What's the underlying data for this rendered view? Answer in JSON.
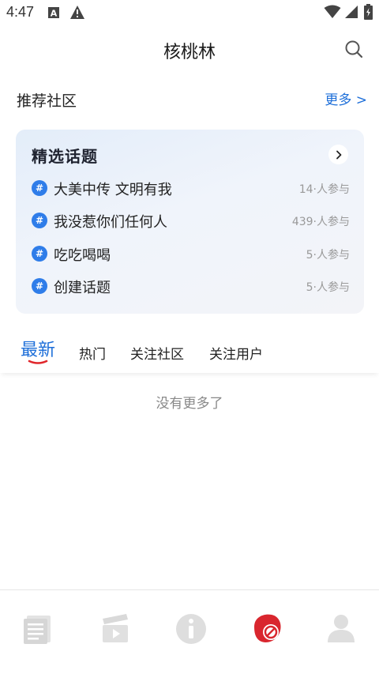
{
  "status_bar": {
    "time": "4:47",
    "icons": [
      "font-a-icon",
      "warning-icon",
      "wifi-icon",
      "signal-icon",
      "battery-icon"
    ]
  },
  "header": {
    "title": "核桃林",
    "search_icon": "search-icon"
  },
  "recommended": {
    "title": "推荐社区",
    "more_label": "更多 >"
  },
  "topics_card": {
    "title": "精选话题",
    "arrow_icon": "chevron-right-icon",
    "hash_symbol": "#",
    "items": [
      {
        "name": "大美中传 文明有我",
        "count": "14·人参与"
      },
      {
        "name": "我没惹你们任何人",
        "count": "439·人参与"
      },
      {
        "name": "吃吃喝喝",
        "count": "5·人参与"
      },
      {
        "name": "创建话题",
        "count": "5·人参与"
      }
    ]
  },
  "tabs": [
    {
      "label": "最新",
      "active": true
    },
    {
      "label": "热门",
      "active": false
    },
    {
      "label": "关注社区",
      "active": false
    },
    {
      "label": "关注用户",
      "active": false
    }
  ],
  "empty_message": "没有更多了",
  "bottom_nav": {
    "items": [
      {
        "icon": "newspaper-icon",
        "active": false
      },
      {
        "icon": "video-clapper-icon",
        "active": false
      },
      {
        "icon": "info-icon",
        "active": false
      },
      {
        "icon": "community-icon",
        "active": true
      },
      {
        "icon": "user-icon",
        "active": false
      }
    ]
  },
  "colors": {
    "accent": "#1e6fd9",
    "underline": "#e0262b",
    "hash_badge": "#2f7de9",
    "nav_inactive": "#e2e2e2",
    "nav_active": "#d9262e"
  }
}
